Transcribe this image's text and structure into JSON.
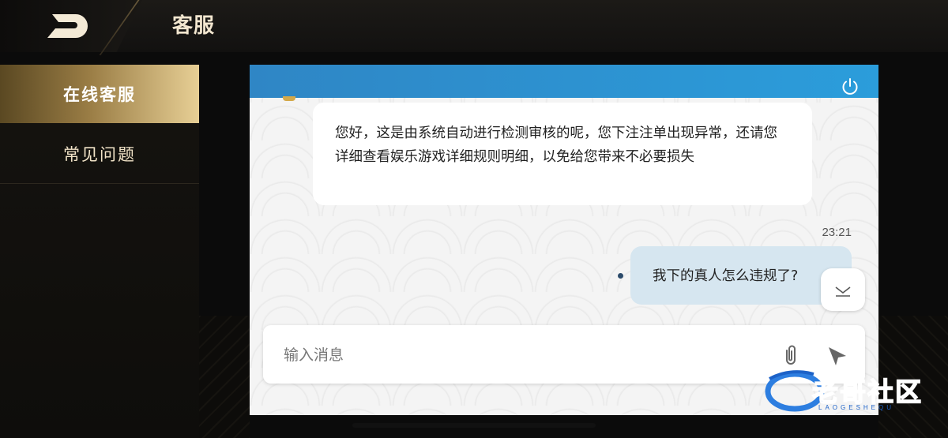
{
  "header": {
    "title": "客服",
    "back_icon": "back-arrow-icon"
  },
  "sidebar": {
    "items": [
      {
        "label": "在线客服",
        "active": true
      },
      {
        "label": "常见问题",
        "active": false
      }
    ]
  },
  "chat": {
    "header_icon": "power-icon",
    "messages": [
      {
        "from": "agent",
        "text": "您好，这是由系统自动进行检测审核的呢，您下注注单出现异常，还请您详细查看娱乐游戏详细规则明细，以免给您带来不必要损失"
      },
      {
        "from": "user",
        "time": "23:21",
        "text": "我下的真人怎么违规了?"
      }
    ],
    "scroll_icon": "chevron-down-icon"
  },
  "composer": {
    "placeholder": "输入消息",
    "attach_icon": "paperclip-icon",
    "send_icon": "send-icon"
  },
  "watermark": {
    "text": "老哥社区",
    "sub": "LAOGESHEQU"
  },
  "colors": {
    "accent": "#2b9ddb",
    "gold": "#e7cf95",
    "user_bubble": "#d6e6f0"
  }
}
